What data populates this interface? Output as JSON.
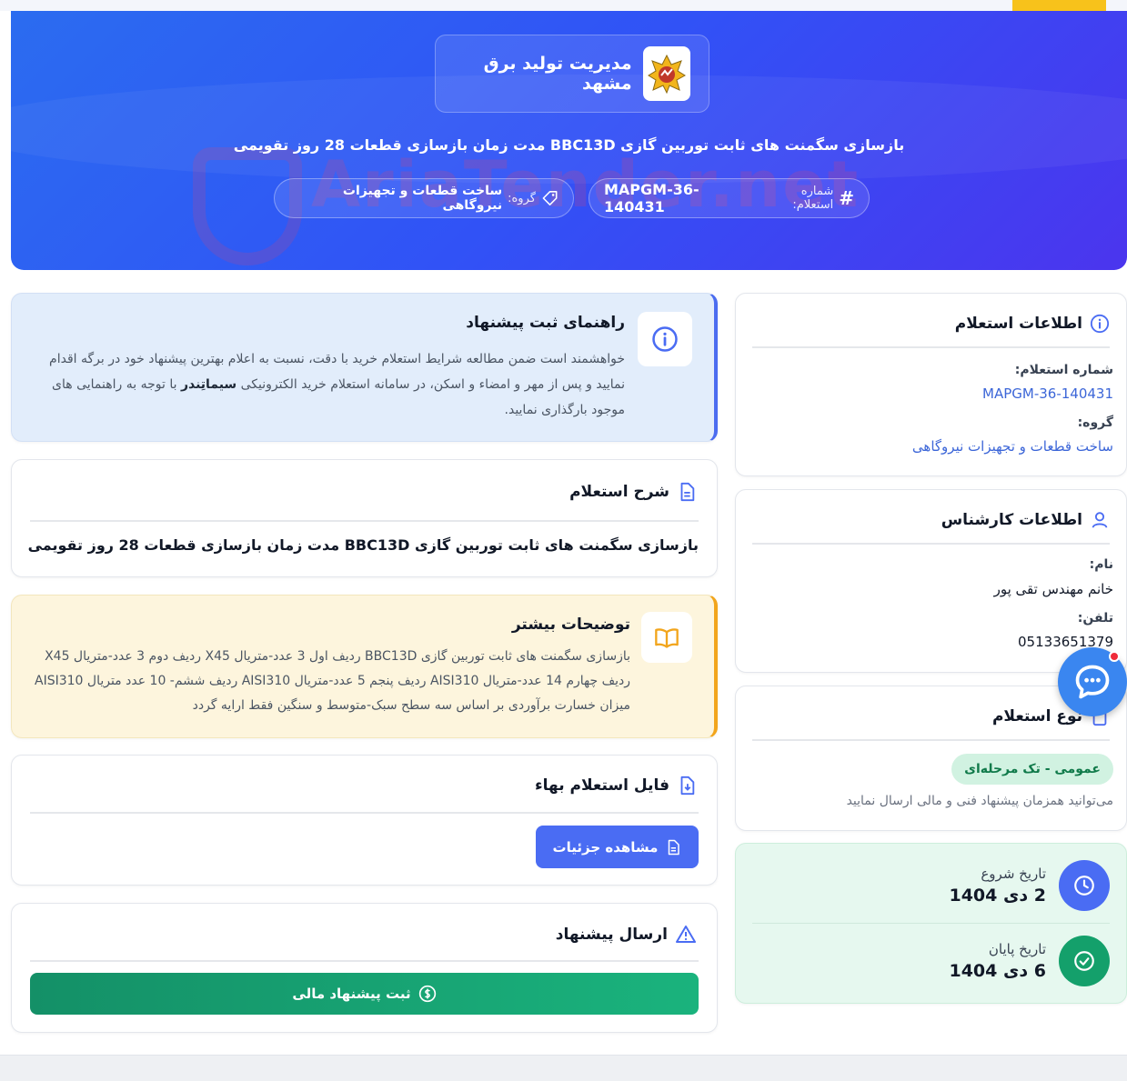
{
  "hero": {
    "org_name": "مدیریت تولید برق مشهد",
    "title": "بازسازی سگمنت های ثابت توربین گازی BBC13D مدت زمان بازسازی قطعات 28 روز تقویمی",
    "number_label": "شماره استعلام:",
    "number_value": "MAPGM-36-140431",
    "group_label": "گروه:",
    "group_value": "ساخت قطعات و تجهیزات نیروگاهی",
    "watermark": "AriaTender.net"
  },
  "guide": {
    "title": "راهنمای ثبت پیشنهاد",
    "text_part1": "خواهشمند است ضمن مطالعه شرایط استعلام خرید با دقت، نسبت به اعلام بهترین پیشنهاد خود در برگه اقدام نمایید و پس از مهر و امضاء و اسکن، در سامانه استعلام خرید الکترونیکی",
    "text_brand": "سیماتِندر",
    "text_part2": "با توجه به راهنمایی های موجود بارگذاری نمایید."
  },
  "description": {
    "title": "شرح استعلام",
    "body": "بازسازی سگمنت های ثابت توربین گازی BBC13D مدت زمان بازسازی قطعات 28 روز تقویمی"
  },
  "more": {
    "title": "توضیحات بیشتر",
    "text": "بازسازی سگمنت های ثابت توربین گازی BBC13D ردیف اول 3 عدد-متریال X45 ردیف دوم 3 عدد-متریال X45 ردیف چهارم 14 عدد-متریال AISI310 ردیف پنجم 5 عدد-متریال AISI310 ردیف ششم- 10 عدد متریال AISI310 میزان خسارت برآوردی بر اساس سه سطح سبک-متوسط و سنگین فقط ارایه گردد"
  },
  "file": {
    "title": "فایل استعلام بهاء",
    "button": "مشاهده جزئیات"
  },
  "send": {
    "title": "ارسال پیشنهاد",
    "button": "ثبت پیشنهاد مالی"
  },
  "info": {
    "title": "اطلاعات استعلام",
    "number_label": "شماره استعلام:",
    "number_value": "MAPGM-36-140431",
    "group_label": "گروه:",
    "group_value": "ساخت قطعات و تجهیزات نیروگاهی"
  },
  "expert": {
    "title": "اطلاعات کارشناس",
    "name_label": "نام:",
    "name_value": "خانم مهندس تقی پور",
    "phone_label": "تلفن:",
    "phone_value": "05133651379"
  },
  "type": {
    "title": "نوع استعلام",
    "badge": "عمومی - تک مرحله‌ای",
    "note": "می‌توانید همزمان پیشنهاد فنی و مالی ارسال نمایید"
  },
  "dates": {
    "start_label": "تاریخ شروع",
    "start_value": "2 دی 1404",
    "end_label": "تاریخ پایان",
    "end_value": "6 دی 1404"
  },
  "colors": {
    "primary": "#4a6cf3",
    "success": "#14a06b",
    "warning": "#f2a51c",
    "link": "#3c66d8"
  }
}
